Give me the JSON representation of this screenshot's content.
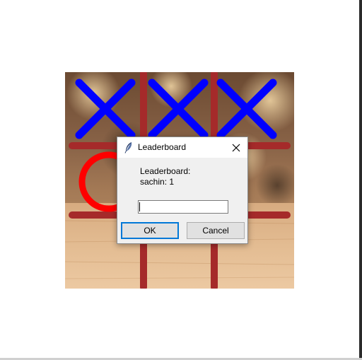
{
  "dialog": {
    "title": "Leaderboard",
    "icon": "feather-icon",
    "message_lines": [
      "Leaderboard:",
      "sachin: 1"
    ],
    "entry_value": "",
    "ok_label": "OK",
    "cancel_label": "Cancel",
    "close_icon": "close-icon"
  },
  "board": {
    "cells": [
      "X",
      "X",
      "X",
      "O",
      "",
      "",
      "",
      "",
      ""
    ],
    "colors": {
      "x_mark": "#0000ff",
      "o_mark": "#ff0000",
      "grid": "#a52a2a"
    }
  }
}
